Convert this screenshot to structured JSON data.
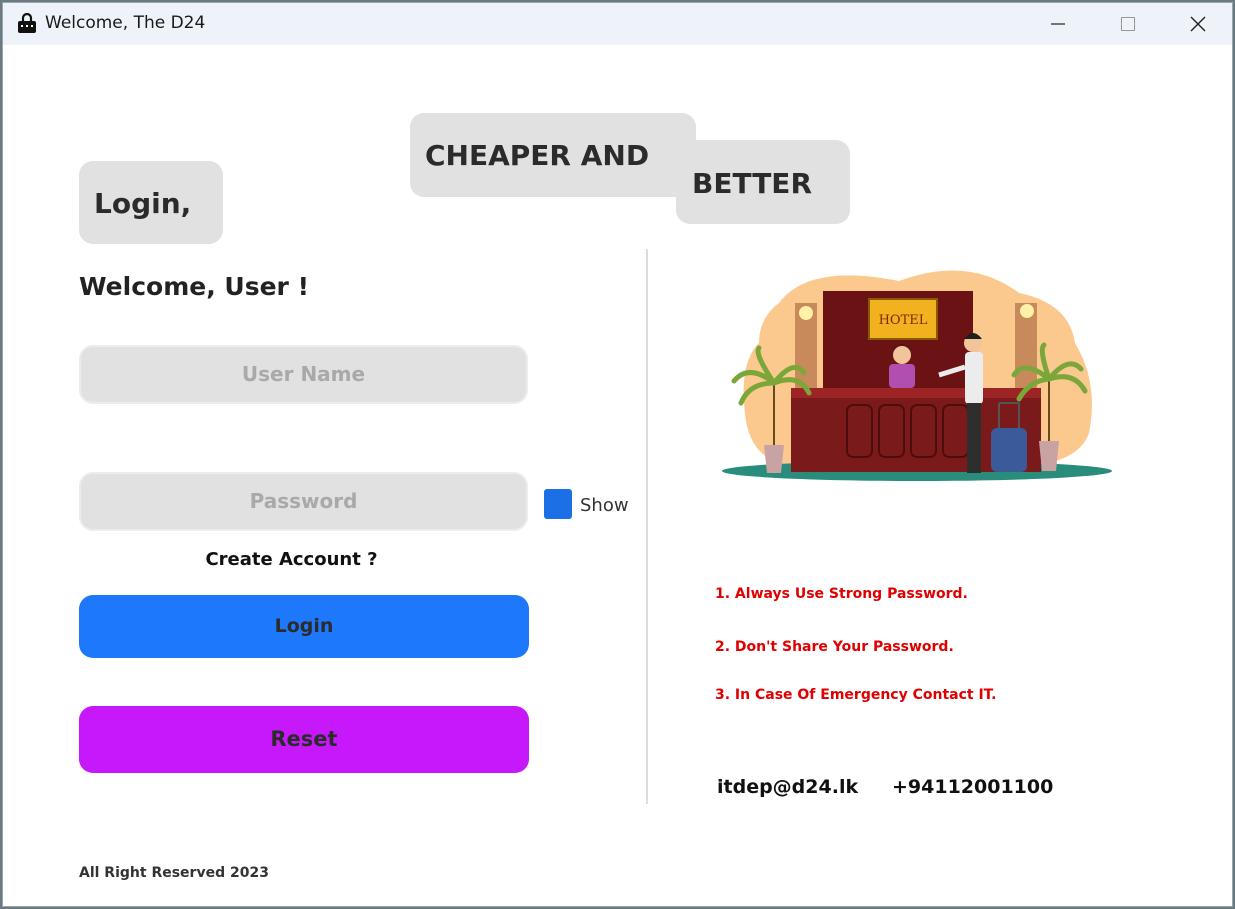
{
  "window": {
    "title": "Welcome, The D24",
    "icon": "lock-briefcase-icon"
  },
  "header": {
    "login_heading": "Login,",
    "slogan_part1": "CHEAPER AND",
    "slogan_part2": "BETTER"
  },
  "form": {
    "welcome": "Welcome, User !",
    "username_placeholder": "User Name",
    "password_placeholder": "Password",
    "show_label": "Show",
    "create_account": "Create Account ?",
    "login_button": "Login",
    "reset_button": "Reset"
  },
  "info": {
    "illustration": "hotel-reception-illustration",
    "illustration_sign": "HOTEL",
    "tips": [
      "1. Always Use Strong Password.",
      "2. Don't Share Your Password.",
      "3. In Case Of Emergency Contact IT."
    ],
    "email": "itdep@d24.lk",
    "phone": "+94112001100"
  },
  "footer": {
    "copyright": "All Right Reserved 2023"
  },
  "colors": {
    "login_button": "#1e78fb",
    "reset_button": "#c718fb",
    "show_checkbox": "#1c6fe5",
    "tips_text": "#e00000",
    "pill_background": "#e1e1e1"
  }
}
